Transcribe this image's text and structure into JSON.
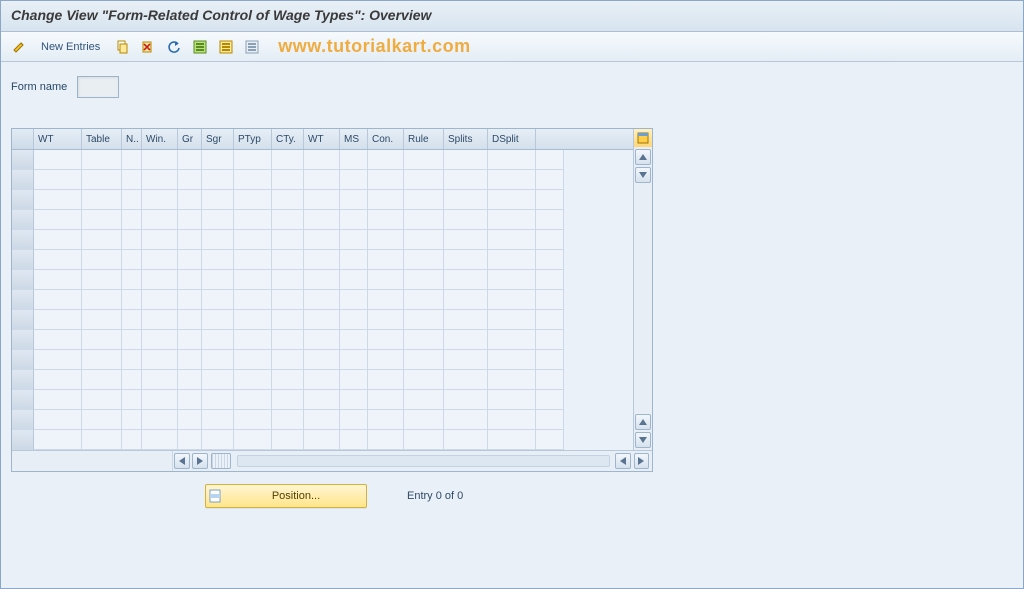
{
  "title": "Change View \"Form-Related Control of Wage Types\": Overview",
  "toolbar": {
    "new_entries": "New Entries"
  },
  "watermark": "www.tutorialkart.com",
  "field": {
    "form_name_label": "Form name",
    "form_name_value": ""
  },
  "grid": {
    "columns": [
      "WT",
      "Table",
      "N..",
      "Win.",
      "Gr",
      "Sgr",
      "PTyp",
      "CTy.",
      "WT",
      "MS",
      "Con.",
      "Rule",
      "Splits",
      "DSplit"
    ],
    "rows": 15
  },
  "footer": {
    "position_label": "Position...",
    "entry_text": "Entry 0 of 0"
  }
}
